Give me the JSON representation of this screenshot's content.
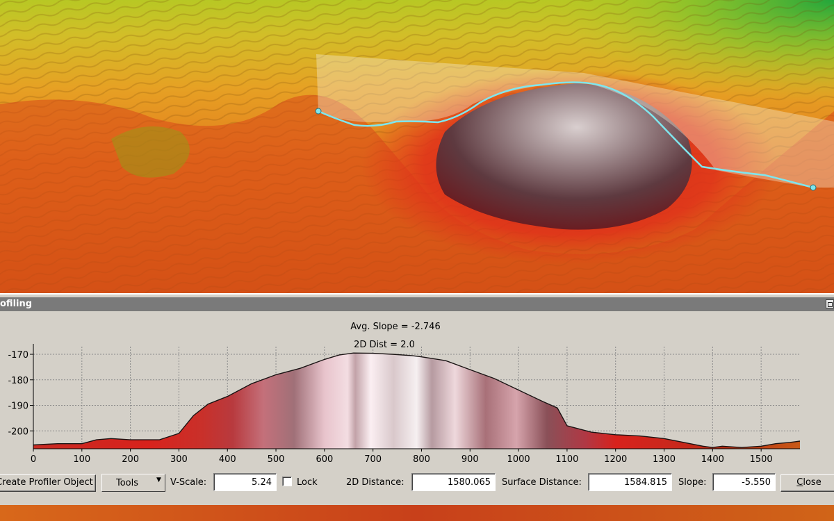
{
  "window": {
    "title": "ofiling"
  },
  "chart_data": {
    "type": "area",
    "annotations": [
      "Avg. Slope = -2.746",
      "2D Dist = 2.0"
    ],
    "xlim": [
      0,
      1580
    ],
    "ylim": [
      -207,
      -167
    ],
    "xticks": [
      0,
      100,
      200,
      300,
      400,
      500,
      600,
      700,
      800,
      900,
      1000,
      1100,
      1200,
      1300,
      1400,
      1500
    ],
    "yticks": [
      -170,
      -180,
      -190,
      -200
    ],
    "grid": true,
    "x": [
      0,
      50,
      100,
      130,
      160,
      200,
      260,
      300,
      330,
      360,
      400,
      450,
      500,
      550,
      600,
      630,
      660,
      700,
      740,
      780,
      800,
      850,
      900,
      950,
      1000,
      1050,
      1080,
      1100,
      1150,
      1200,
      1250,
      1300,
      1340,
      1380,
      1400,
      1420,
      1460,
      1500,
      1530,
      1560,
      1580
    ],
    "y": [
      -205.5,
      -205,
      -205,
      -203.5,
      -203,
      -203.5,
      -203.5,
      -201,
      -194,
      -189.5,
      -186.5,
      -181.5,
      -178,
      -175.5,
      -172,
      -170.3,
      -169.5,
      -169.6,
      -170,
      -170.5,
      -171,
      -172.5,
      -176,
      -179.5,
      -184,
      -188.5,
      -191,
      -198,
      -200.5,
      -201.5,
      -202,
      -203,
      -204.5,
      -206,
      -206.5,
      -206,
      -206.5,
      -206,
      -205,
      -204.5,
      -204
    ]
  },
  "controls": {
    "create_profiler": "Create Profiler Object",
    "tools": "Tools",
    "tools_arrow": "▼",
    "vscale_label": "V-Scale:",
    "vscale_value": "5.24",
    "lock_label": "Lock",
    "dist2d_label": "2D Distance:",
    "dist2d_value": "1580.065",
    "surface_label": "Surface Distance:",
    "surface_value": "1584.815",
    "slope_label": "Slope:",
    "slope_value": "-5.550",
    "close_u": "C",
    "close_rest": "lose"
  },
  "colors": {
    "terrain_low": "#c0330f",
    "terrain_mid": "#e8801c",
    "terrain_high": "#c9c82a",
    "terrain_top": "#2fae3a",
    "profile_line": "#7fe6ee",
    "panel_bg": "#d4d0c8"
  },
  "icons": {
    "restore": "window-restore-icon",
    "dropdown": "chevron-down-icon"
  }
}
